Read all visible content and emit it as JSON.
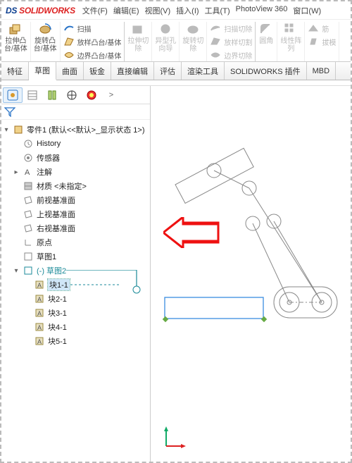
{
  "app": {
    "brand_ds": "DS",
    "brand_sw": " SOLIDWORKS"
  },
  "menu": {
    "file": "文件(F)",
    "edit": "编辑(E)",
    "view": "视图(V)",
    "insert": "插入(I)",
    "tools": "工具(T)",
    "pv360": "PhotoView 360",
    "window": "窗口(W)"
  },
  "ribbon": {
    "extrude": "拉伸凸\n台/基体",
    "revolve": "旋转凸\n台/基体",
    "sweep": "扫描",
    "loft": "放样凸台/基体",
    "boundary": "边界凸台/基体",
    "cut_extrude": "拉伸切\n除",
    "hole": "异型孔\n向导",
    "cut_revolve": "旋转切\n除",
    "cut_sweep": "扫描切除",
    "cut_loft": "放样切割",
    "cut_boundary": "边界切除",
    "fillet": "圆角",
    "lpattern": "线性阵\n列",
    "rib": "筋",
    "draft": "拔模"
  },
  "tabs": {
    "feature": "特征",
    "sketch": "草图",
    "surface": "曲面",
    "sheetmetal": "钣金",
    "direct": "直接编辑",
    "evaluate": "评估",
    "render": "渲染工具",
    "addins": "SOLIDWORKS 插件",
    "mbd": "MBD"
  },
  "tree": {
    "root": "零件1 (默认<<默认>_显示状态 1>)",
    "history": "History",
    "sensors": "传感器",
    "annotations": "注解",
    "material": "材质 <未指定>",
    "front": "前视基准面",
    "top": "上视基准面",
    "right": "右视基准面",
    "origin": "原点",
    "sketch1": "草图1",
    "sketch2": "(-) 草图2",
    "block1": "块1-1",
    "block2": "块2-1",
    "block3": "块3-1",
    "block4": "块4-1",
    "block5": "块5-1"
  },
  "sidepanel_more": ">"
}
